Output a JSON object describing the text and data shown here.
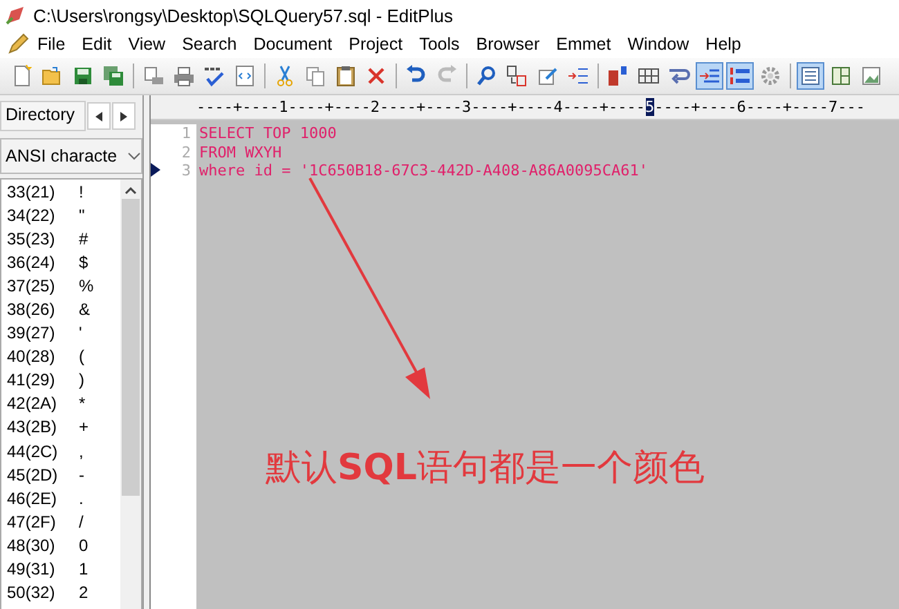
{
  "window": {
    "title": "C:\\Users\\rongsy\\Desktop\\SQLQuery57.sql - EditPlus"
  },
  "menu": [
    "File",
    "Edit",
    "View",
    "Search",
    "Document",
    "Project",
    "Tools",
    "Browser",
    "Emmet",
    "Window",
    "Help"
  ],
  "toolbar": [
    [
      {
        "kind": "new",
        "pressed": false
      },
      {
        "kind": "open",
        "pressed": false
      },
      {
        "kind": "save",
        "pressed": false
      },
      {
        "kind": "save-all",
        "pressed": false
      }
    ],
    [
      {
        "kind": "preview",
        "pressed": false
      },
      {
        "kind": "print",
        "pressed": false
      },
      {
        "kind": "spell",
        "pressed": false
      },
      {
        "kind": "browser",
        "pressed": false
      }
    ],
    [
      {
        "kind": "cut",
        "pressed": false
      },
      {
        "kind": "copy",
        "pressed": false
      },
      {
        "kind": "paste",
        "pressed": false
      },
      {
        "kind": "delete",
        "pressed": false
      }
    ],
    [
      {
        "kind": "undo",
        "pressed": false
      },
      {
        "kind": "redo",
        "pressed": false
      }
    ],
    [
      {
        "kind": "find",
        "pressed": false
      },
      {
        "kind": "replace",
        "pressed": false
      },
      {
        "kind": "window",
        "pressed": false
      },
      {
        "kind": "goto",
        "pressed": false
      }
    ],
    [
      {
        "kind": "font",
        "pressed": false
      },
      {
        "kind": "hex",
        "pressed": false
      },
      {
        "kind": "wrap",
        "pressed": false
      },
      {
        "kind": "indent",
        "pressed": true
      },
      {
        "kind": "numbers",
        "pressed": true
      },
      {
        "kind": "gear",
        "pressed": false
      }
    ],
    [
      {
        "kind": "panel",
        "pressed": true
      },
      {
        "kind": "panel2",
        "pressed": false
      },
      {
        "kind": "image",
        "pressed": false
      }
    ]
  ],
  "sidebar": {
    "tab": "Directory",
    "dropdown": "ANSI characte",
    "rows": [
      {
        "code": "33(21)",
        "char": "!"
      },
      {
        "code": "34(22)",
        "char": "\""
      },
      {
        "code": "35(23)",
        "char": "#"
      },
      {
        "code": "36(24)",
        "char": "$"
      },
      {
        "code": "37(25)",
        "char": "%"
      },
      {
        "code": "38(26)",
        "char": "&"
      },
      {
        "code": "39(27)",
        "char": "'"
      },
      {
        "code": "40(28)",
        "char": "("
      },
      {
        "code": "41(29)",
        "char": ")"
      },
      {
        "code": "42(2A)",
        "char": "*"
      },
      {
        "code": "43(2B)",
        "char": "+"
      },
      {
        "code": "44(2C)",
        "char": ","
      },
      {
        "code": "45(2D)",
        "char": "-"
      },
      {
        "code": "46(2E)",
        "char": "."
      },
      {
        "code": "47(2F)",
        "char": "/"
      },
      {
        "code": "48(30)",
        "char": "0"
      },
      {
        "code": "49(31)",
        "char": "1"
      },
      {
        "code": "50(32)",
        "char": "2"
      }
    ]
  },
  "editor": {
    "ruler": {
      "before": "----+----1----+----2----+----3----+----4----+----",
      "current": "5",
      "after": "----+----6----+----7---"
    },
    "lines": [
      {
        "number": "1",
        "text": "SELECT TOP 1000",
        "current": false
      },
      {
        "number": "2",
        "text": "FROM WXYH",
        "current": false
      },
      {
        "number": "3",
        "text": "where id = '1C650B18-67C3-442D-A408-A86A0095CA61'",
        "current": true
      }
    ]
  },
  "annotation": {
    "text": "默认**SQL**语句都是一个颜色"
  }
}
